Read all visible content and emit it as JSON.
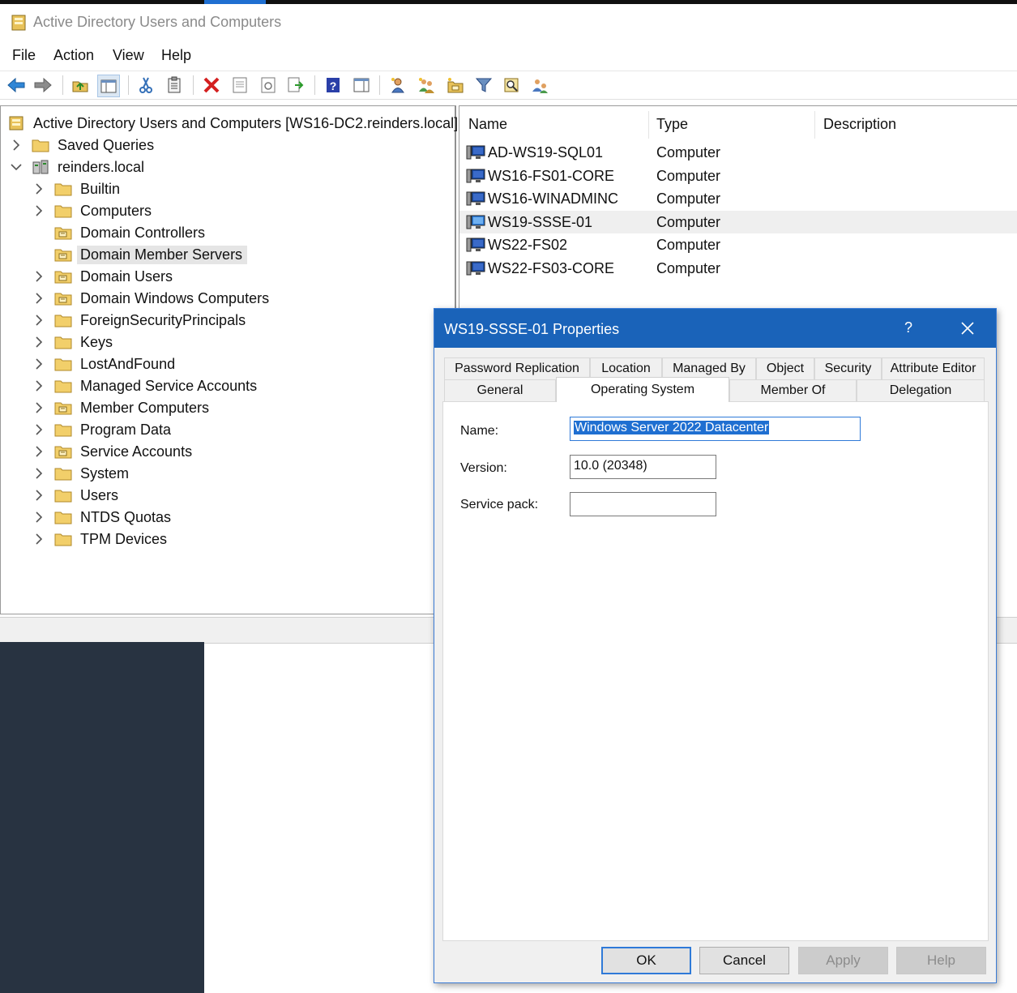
{
  "window": {
    "title": "Active Directory Users and Computers"
  },
  "menu": {
    "file": "File",
    "action": "Action",
    "view": "View",
    "help": "Help"
  },
  "toolbar": {
    "icons": [
      "back-arrow-icon",
      "forward-arrow-icon",
      "up-folder-icon",
      "show-hide-tree-icon",
      "cut-icon",
      "paste-icon",
      "delete-icon",
      "properties-icon",
      "refresh-icon",
      "export-list-icon",
      "help-icon",
      "action-pane-icon",
      "new-user-icon",
      "new-group-icon",
      "new-ou-icon",
      "filter-icon",
      "find-icon",
      "add-to-group-icon"
    ]
  },
  "tree": {
    "root": "Active Directory Users and Computers [WS16-DC2.reinders.local]",
    "saved_queries": "Saved Queries",
    "domain": "reinders.local",
    "items": [
      {
        "label": "Builtin",
        "type": "container",
        "expandable": true
      },
      {
        "label": "Computers",
        "type": "container",
        "expandable": true
      },
      {
        "label": "Domain Controllers",
        "type": "ou",
        "expandable": false
      },
      {
        "label": "Domain Member Servers",
        "type": "ou",
        "expandable": false,
        "selected": true
      },
      {
        "label": "Domain Users",
        "type": "ou",
        "expandable": true
      },
      {
        "label": "Domain Windows Computers",
        "type": "ou",
        "expandable": true
      },
      {
        "label": "ForeignSecurityPrincipals",
        "type": "container",
        "expandable": true
      },
      {
        "label": "Keys",
        "type": "container",
        "expandable": true
      },
      {
        "label": "LostAndFound",
        "type": "container",
        "expandable": true
      },
      {
        "label": "Managed Service Accounts",
        "type": "container",
        "expandable": true
      },
      {
        "label": "Member Computers",
        "type": "ou",
        "expandable": true
      },
      {
        "label": "Program Data",
        "type": "container",
        "expandable": true
      },
      {
        "label": "Service Accounts",
        "type": "ou",
        "expandable": true
      },
      {
        "label": "System",
        "type": "container",
        "expandable": true
      },
      {
        "label": "Users",
        "type": "container",
        "expandable": true
      },
      {
        "label": "NTDS Quotas",
        "type": "container",
        "expandable": true
      },
      {
        "label": "TPM Devices",
        "type": "container",
        "expandable": true
      }
    ]
  },
  "list": {
    "columns": {
      "name": "Name",
      "type": "Type",
      "description": "Description"
    },
    "rows": [
      {
        "name": "AD-WS19-SQL01",
        "type": "Computer"
      },
      {
        "name": "WS16-FS01-CORE",
        "type": "Computer"
      },
      {
        "name": "WS16-WINADMINC",
        "type": "Computer"
      },
      {
        "name": "WS19-SSSE-01",
        "type": "Computer",
        "highlight": true
      },
      {
        "name": "WS22-FS02",
        "type": "Computer"
      },
      {
        "name": "WS22-FS03-CORE",
        "type": "Computer"
      }
    ]
  },
  "dialog": {
    "title": "WS19-SSSE-01 Properties",
    "help_glyph": "?",
    "tabs_row1": [
      "Password Replication",
      "Location",
      "Managed By",
      "Object",
      "Security",
      "Attribute Editor"
    ],
    "tabs_row2": [
      "General",
      "Operating System",
      "Member Of",
      "Delegation"
    ],
    "active_tab": "Operating System",
    "fields": {
      "name_label": "Name:",
      "name_value": "Windows Server 2022 Datacenter",
      "version_label": "Version:",
      "version_value": "10.0 (20348)",
      "sp_label": "Service pack:",
      "sp_value": ""
    },
    "buttons": {
      "ok": "OK",
      "cancel": "Cancel",
      "apply": "Apply",
      "help": "Help"
    }
  },
  "colors": {
    "dialog_title": "#1a63b9",
    "selection": "#1f6fd1",
    "desktop": "#283341"
  }
}
